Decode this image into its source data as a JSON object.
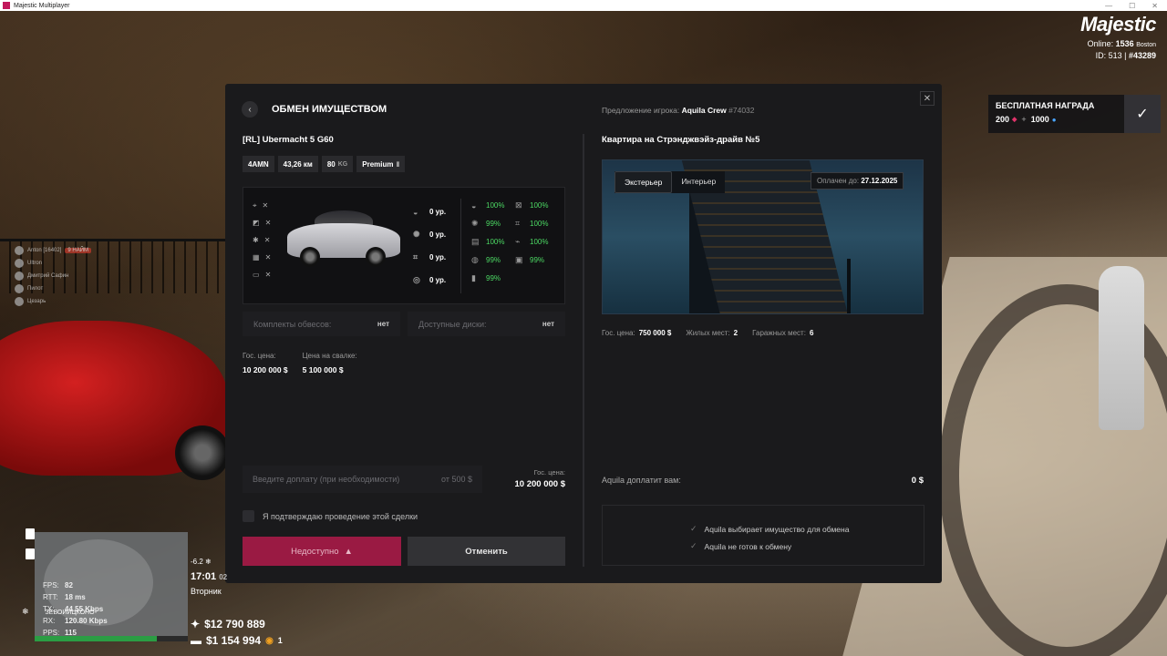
{
  "window": {
    "title": "Majestic Multiplayer"
  },
  "brand": {
    "logo": "Majestic",
    "online_label": "Online:",
    "online_count": "1536",
    "server": "Boston",
    "id_label": "ID: 513 |",
    "id_value": "#43289"
  },
  "reward": {
    "title": "БЕСПЛАТНАЯ НАГРАДА",
    "amount1": "200",
    "plus": "+",
    "amount2": "1000",
    "check": "✓"
  },
  "chat": [
    {
      "name": "Anton [16402]",
      "tag": "9 НАЙМ"
    },
    {
      "name": "Ultron",
      "tag": ""
    },
    {
      "name": "Дмитрий Сафин",
      "tag": ""
    },
    {
      "name": "Пилот",
      "tag": ""
    },
    {
      "name": "Цезарь",
      "tag": ""
    }
  ],
  "modal": {
    "title": "ОБМЕН ИМУЩЕСТВОМ",
    "close": "✕",
    "back": "‹",
    "left": {
      "item_name": "[RL] Ubermacht 5 G60",
      "tags": [
        "4AMN",
        "43,26 км",
        "80",
        "Premium"
      ],
      "mods_off": [
        "✕",
        "✕",
        "✕",
        "✕",
        "✕"
      ],
      "levels": [
        "0 ур.",
        "0 ур.",
        "0 ур.",
        "0 ур."
      ],
      "stats": [
        "100%",
        "100%",
        "99%",
        "100%",
        "100%",
        "100%",
        "99%",
        "99%",
        "99%"
      ],
      "kits_label": "Комплекты обвесов:",
      "kits_value": "нет",
      "disks_label": "Доступные диски:",
      "disks_value": "нет",
      "gov_price_label": "Гос. цена:",
      "gov_price": "10 200 000 $",
      "scrap_price_label": "Цена на свалке:",
      "scrap_price": "5 100 000 $",
      "topup_placeholder": "Введите доплату (при необходимости)",
      "topup_min": "от 500 $",
      "topup_gov_label": "Гос. цена:",
      "topup_gov_price": "10 200 000 $",
      "confirm_label": "Я подтверждаю проведение этой сделки",
      "unavailable_label": "Недоступно",
      "cancel_label": "Отменить"
    },
    "right": {
      "offer_label": "Предложение игрока:",
      "offer_player": "Aquila Crew",
      "offer_id": "#74032",
      "property_name": "Квартира на Стрэнджвэйз-драйв №5",
      "tab_exterior": "Экстерьер",
      "tab_interior": "Интерьер",
      "paid_label": "Оплачен до:",
      "paid_until": "27.12.2025",
      "gov_label": "Гос. цена:",
      "gov_price": "750 000 $",
      "living_label": "Жилых мест:",
      "living_value": "2",
      "garage_label": "Гаражных мест:",
      "garage_value": "6",
      "pays_label": "Aquila доплатит вам:",
      "pays_value": "0 $",
      "status": [
        "Aquila выбирает имущество для обмена",
        "Aquila не готов к обмену"
      ]
    }
  },
  "hud": {
    "fps_label": "FPS:",
    "fps": "82",
    "rtt_label": "RTT:",
    "rtt": "18 ms",
    "tx_label": "TX:",
    "tx": "44.55 Kbps",
    "rx_label": "RX:",
    "rx": "120.80 Kbps",
    "pps_label": "PPS:",
    "pps": "115",
    "stability": "ЗЕВОИИЦКОНО",
    "temp": "-6.2",
    "clock": "17:01",
    "clock_suffix": "02",
    "day": "Вторник",
    "cash": "$12 790 889",
    "bank": "$1 154 994",
    "coins": "1",
    "health_percent": 80
  }
}
